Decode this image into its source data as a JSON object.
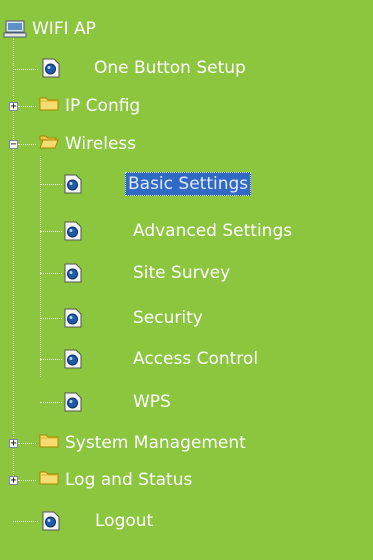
{
  "root": {
    "label": "WIFI AP"
  },
  "items": {
    "one_button_setup": "One Button Setup",
    "ip_config": "IP Config",
    "wireless": "Wireless",
    "basic_settings": "Basic Settings",
    "advanced_settings": "Advanced Settings",
    "site_survey": "Site Survey",
    "security": "Security",
    "access_control": "Access Control",
    "wps": "WPS",
    "system_management": "System Management",
    "log_and_status": "Log and Status",
    "logout": "Logout"
  },
  "expander": {
    "plus": "+",
    "minus": "−"
  },
  "selected": "basic_settings",
  "colors": {
    "background": "#8cc63f",
    "selection": "#316ac5",
    "text": "#ffffff"
  }
}
